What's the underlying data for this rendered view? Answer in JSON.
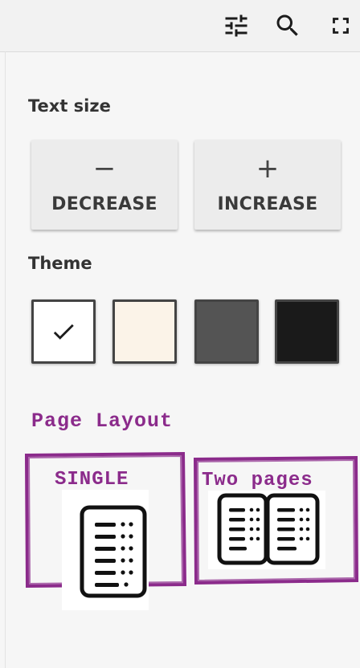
{
  "toolbar": {
    "icons": [
      "tune-icon",
      "search-icon",
      "fullscreen-icon"
    ]
  },
  "text_size": {
    "title": "Text size",
    "decrease_symbol": "−",
    "decrease_label": "DECREASE",
    "increase_symbol": "+",
    "increase_label": "INCREASE"
  },
  "theme": {
    "title": "Theme",
    "swatches": [
      {
        "name": "white",
        "color": "#ffffff",
        "selected": true
      },
      {
        "name": "sepia",
        "color": "#fbf3e8",
        "selected": false
      },
      {
        "name": "gray",
        "color": "#545454",
        "selected": false
      },
      {
        "name": "black",
        "color": "#1a1a1a",
        "selected": false
      }
    ]
  },
  "page_layout": {
    "title": "Page Layout",
    "single_label": "SINGLE",
    "two_pages_label": "Two pages",
    "accent_color": "#8b2b8b"
  }
}
